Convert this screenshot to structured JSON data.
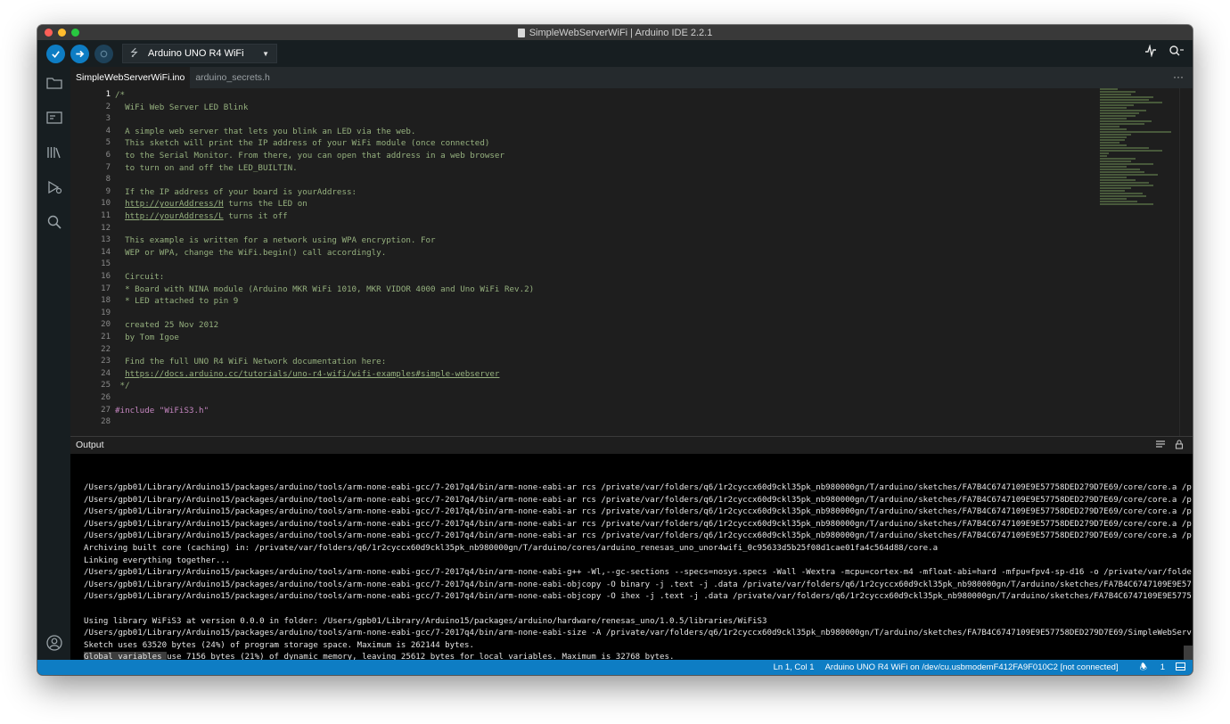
{
  "window": {
    "title": "SimpleWebServerWiFi | Arduino IDE 2.2.1"
  },
  "toolbar": {
    "verify_icon": "check-icon",
    "upload_icon": "arrow-right-icon",
    "debug_icon": "debug-icon",
    "board": "Arduino UNO R4 WiFi",
    "serial_plotter_icon": "pulse-icon",
    "serial_monitor_icon": "magnifier-dots-icon"
  },
  "activity": [
    "folder-icon",
    "boards-icon",
    "library-icon",
    "debug-icon",
    "search-icon",
    "account-icon"
  ],
  "tabs": [
    {
      "label": "SimpleWebServerWiFi.ino",
      "active": true
    },
    {
      "label": "arduino_secrets.h",
      "active": false
    }
  ],
  "tabs_more": "···",
  "editor": {
    "lines": [
      {
        "n": "1",
        "text": "/*",
        "kind": "comment"
      },
      {
        "n": "2",
        "text": "  WiFi Web Server LED Blink",
        "kind": "comment"
      },
      {
        "n": "3",
        "text": "",
        "kind": "comment"
      },
      {
        "n": "4",
        "text": "  A simple web server that lets you blink an LED via the web.",
        "kind": "comment"
      },
      {
        "n": "5",
        "text": "  This sketch will print the IP address of your WiFi module (once connected)",
        "kind": "comment"
      },
      {
        "n": "6",
        "text": "  to the Serial Monitor. From there, you can open that address in a web browser",
        "kind": "comment"
      },
      {
        "n": "7",
        "text": "  to turn on and off the LED_BUILTIN.",
        "kind": "comment"
      },
      {
        "n": "8",
        "text": "",
        "kind": "comment"
      },
      {
        "n": "9",
        "text": "  If the IP address of your board is yourAddress:",
        "kind": "comment"
      },
      {
        "n": "10",
        "link": "http://yourAddress/H",
        "rest": " turns the LED on",
        "kind": "link"
      },
      {
        "n": "11",
        "link": "http://yourAddress/L",
        "rest": " turns it off",
        "kind": "link"
      },
      {
        "n": "12",
        "text": "",
        "kind": "comment"
      },
      {
        "n": "13",
        "text": "  This example is written for a network using WPA encryption. For",
        "kind": "comment"
      },
      {
        "n": "14",
        "text": "  WEP or WPA, change the WiFi.begin() call accordingly.",
        "kind": "comment"
      },
      {
        "n": "15",
        "text": "",
        "kind": "comment"
      },
      {
        "n": "16",
        "text": "  Circuit:",
        "kind": "comment"
      },
      {
        "n": "17",
        "text": "  * Board with NINA module (Arduino MKR WiFi 1010, MKR VIDOR 4000 and Uno WiFi Rev.2)",
        "kind": "comment"
      },
      {
        "n": "18",
        "text": "  * LED attached to pin 9",
        "kind": "comment"
      },
      {
        "n": "19",
        "text": "",
        "kind": "comment"
      },
      {
        "n": "20",
        "text": "  created 25 Nov 2012",
        "kind": "comment"
      },
      {
        "n": "21",
        "text": "  by Tom Igoe",
        "kind": "comment"
      },
      {
        "n": "22",
        "text": "",
        "kind": "comment"
      },
      {
        "n": "23",
        "text": "  Find the full UNO R4 WiFi Network documentation here:",
        "kind": "comment"
      },
      {
        "n": "24",
        "link": "https://docs.arduino.cc/tutorials/uno-r4-wifi/wifi-examples#simple-webserver",
        "rest": "",
        "kind": "link"
      },
      {
        "n": "25",
        "text": " */",
        "kind": "comment"
      },
      {
        "n": "26",
        "text": "",
        "kind": "comment"
      },
      {
        "n": "27",
        "pp": "#include",
        "str": " \"WiFiS3.h\"",
        "kind": "include"
      },
      {
        "n": "28",
        "text": "",
        "kind": "comment"
      }
    ]
  },
  "output": {
    "title": "Output",
    "icons": [
      "clear-output-icon",
      "lock-icon"
    ],
    "lines": [
      "/Users/gpb01/Library/Arduino15/packages/arduino/tools/arm-none-eabi-gcc/7-2017q4/bin/arm-none-eabi-ar rcs /private/var/folders/q6/1r2cyccx60d9ckl35pk_nb980000gn/T/arduino/sketches/FA7B4C6747109E9E57758DED279D7E69/core/core.a /p",
      "/Users/gpb01/Library/Arduino15/packages/arduino/tools/arm-none-eabi-gcc/7-2017q4/bin/arm-none-eabi-ar rcs /private/var/folders/q6/1r2cyccx60d9ckl35pk_nb980000gn/T/arduino/sketches/FA7B4C6747109E9E57758DED279D7E69/core/core.a /p",
      "/Users/gpb01/Library/Arduino15/packages/arduino/tools/arm-none-eabi-gcc/7-2017q4/bin/arm-none-eabi-ar rcs /private/var/folders/q6/1r2cyccx60d9ckl35pk_nb980000gn/T/arduino/sketches/FA7B4C6747109E9E57758DED279D7E69/core/core.a /p",
      "/Users/gpb01/Library/Arduino15/packages/arduino/tools/arm-none-eabi-gcc/7-2017q4/bin/arm-none-eabi-ar rcs /private/var/folders/q6/1r2cyccx60d9ckl35pk_nb980000gn/T/arduino/sketches/FA7B4C6747109E9E57758DED279D7E69/core/core.a /p",
      "/Users/gpb01/Library/Arduino15/packages/arduino/tools/arm-none-eabi-gcc/7-2017q4/bin/arm-none-eabi-ar rcs /private/var/folders/q6/1r2cyccx60d9ckl35pk_nb980000gn/T/arduino/sketches/FA7B4C6747109E9E57758DED279D7E69/core/core.a /p",
      "Archiving built core (caching) in: /private/var/folders/q6/1r2cyccx60d9ckl35pk_nb980000gn/T/arduino/cores/arduino_renesas_uno_unor4wifi_0c95633d5b25f08d1cae01fa4c564d88/core.a",
      "Linking everything together...",
      "/Users/gpb01/Library/Arduino15/packages/arduino/tools/arm-none-eabi-gcc/7-2017q4/bin/arm-none-eabi-g++ -Wl,--gc-sections --specs=nosys.specs -Wall -Wextra -mcpu=cortex-m4 -mfloat-abi=hard -mfpu=fpv4-sp-d16 -o /private/var/folde",
      "/Users/gpb01/Library/Arduino15/packages/arduino/tools/arm-none-eabi-gcc/7-2017q4/bin/arm-none-eabi-objcopy -O binary -j .text -j .data /private/var/folders/q6/1r2cyccx60d9ckl35pk_nb980000gn/T/arduino/sketches/FA7B4C6747109E9E57",
      "/Users/gpb01/Library/Arduino15/packages/arduino/tools/arm-none-eabi-gcc/7-2017q4/bin/arm-none-eabi-objcopy -O ihex -j .text -j .data /private/var/folders/q6/1r2cyccx60d9ckl35pk_nb980000gn/T/arduino/sketches/FA7B4C6747109E9E5775",
      "",
      "Using library WiFiS3 at version 0.0.0 in folder: /Users/gpb01/Library/Arduino15/packages/arduino/hardware/renesas_uno/1.0.5/libraries/WiFiS3",
      "/Users/gpb01/Library/Arduino15/packages/arduino/tools/arm-none-eabi-gcc/7-2017q4/bin/arm-none-eabi-size -A /private/var/folders/q6/1r2cyccx60d9ckl35pk_nb980000gn/T/arduino/sketches/FA7B4C6747109E9E57758DED279D7E69/SimpleWebServ",
      "Sketch uses 63520 bytes (24%) of program storage space. Maximum is 262144 bytes.",
      "Global variables use 7156 bytes (21%) of dynamic memory, leaving 25612 bytes for local variables. Maximum is 32768 bytes."
    ]
  },
  "statusbar": {
    "position": "Ln 1, Col 1",
    "board_port": "Arduino UNO R4 WiFi on /dev/cu.usbmodemF412FA9F010C2 [not connected]",
    "notifications": "1",
    "notification_icon": "bell-icon",
    "panel_icon": "panel-layout-icon"
  },
  "colors": {
    "accent": "#0e7dc4",
    "comment": "#95b07e",
    "preprocessor": "#c586c0",
    "string": "#d7a26a"
  }
}
